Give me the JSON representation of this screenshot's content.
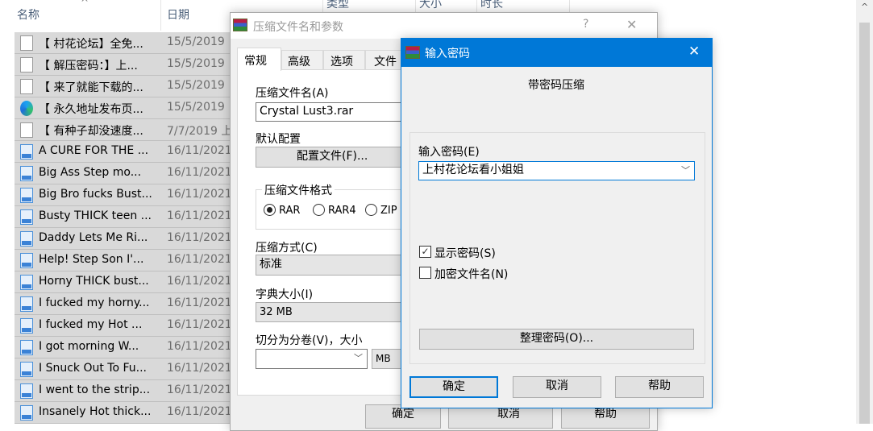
{
  "explorer": {
    "columns": [
      "名称",
      "日期",
      "类型",
      "大小",
      "时长"
    ],
    "rows": [
      {
        "icon": "text-file-icon",
        "name": "【 村花论坛】全免...",
        "date": "15/5/2019"
      },
      {
        "icon": "image-file-icon",
        "name": "【 解压密码：】上...",
        "date": "15/5/2019"
      },
      {
        "icon": "text-file-icon",
        "name": "【 来了就能下载的...",
        "date": "15/5/2019"
      },
      {
        "icon": "edge-shortcut-icon",
        "name": "【 永久地址发布页...",
        "date": "15/5/2019"
      },
      {
        "icon": "text-file-icon",
        "name": "【 有种子却没速度...",
        "date": "7/7/2019 上"
      },
      {
        "icon": "mp4-file-icon",
        "name": "A CURE FOR THE ...",
        "date": "16/11/2021"
      },
      {
        "icon": "mp4-file-icon",
        "name": "Big Ass Step mo...",
        "date": "16/11/2021"
      },
      {
        "icon": "mp4-file-icon",
        "name": "Big Bro fucks Bust...",
        "date": "16/11/2021"
      },
      {
        "icon": "mp4-file-icon",
        "name": "Busty THICK teen ...",
        "date": "16/11/2021"
      },
      {
        "icon": "mp4-file-icon",
        "name": "Daddy Lets Me Ri...",
        "date": "16/11/2021"
      },
      {
        "icon": "mp4-file-icon",
        "name": "Help! Step Son I'...",
        "date": "16/11/2021"
      },
      {
        "icon": "mp4-file-icon",
        "name": "Horny THICK bust...",
        "date": "16/11/2021"
      },
      {
        "icon": "mp4-file-icon",
        "name": "I fucked my horny...",
        "date": "16/11/2021"
      },
      {
        "icon": "mp4-file-icon",
        "name": "I fucked my Hot  ...",
        "date": "16/11/2021"
      },
      {
        "icon": "mp4-file-icon",
        "name": "I got morning W...",
        "date": "16/11/2021"
      },
      {
        "icon": "mp4-file-icon",
        "name": "I Snuck Out To Fu...",
        "date": "16/11/2021"
      },
      {
        "icon": "mp4-file-icon",
        "name": "I went to the strip...",
        "date": "16/11/2021"
      },
      {
        "icon": "mp4-file-icon",
        "name": "Insanely Hot thick...",
        "date": "16/11/2021"
      }
    ]
  },
  "archive_dialog": {
    "title": "压缩文件名和参数",
    "help": "?",
    "close": "✕",
    "tabs": [
      "常规",
      "高级",
      "选项",
      "文件"
    ],
    "archive_name_label": "压缩文件名(A)",
    "archive_name_value": "Crystal Lust3.rar",
    "default_profile_label": "默认配置",
    "profiles_button": "配置文件(F)...",
    "format_group": "压缩文件格式",
    "formats": [
      "RAR",
      "RAR4",
      "ZIP"
    ],
    "selected_format": "RAR",
    "method_label": "压缩方式(C)",
    "method_value": "标准",
    "dict_label": "字典大小(I)",
    "dict_value": "32 MB",
    "split_label": "切分为分卷(V)，大小",
    "split_value": "",
    "split_unit": "MB",
    "ok": "确定",
    "cancel": "取消",
    "help_button": "帮助"
  },
  "password_dialog": {
    "title": "输入密码",
    "close": "✕",
    "heading": "带密码压缩",
    "password_label": "输入密码(E)",
    "password_value": "上村花论坛看小姐姐",
    "show_password": "显示密码(S)",
    "show_password_checked": true,
    "encrypt_names": "加密文件名(N)",
    "encrypt_names_checked": false,
    "organize_button": "整理密码(O)...",
    "ok": "确定",
    "cancel": "取消",
    "help_button": "帮助",
    "accent": "#0078d7"
  }
}
